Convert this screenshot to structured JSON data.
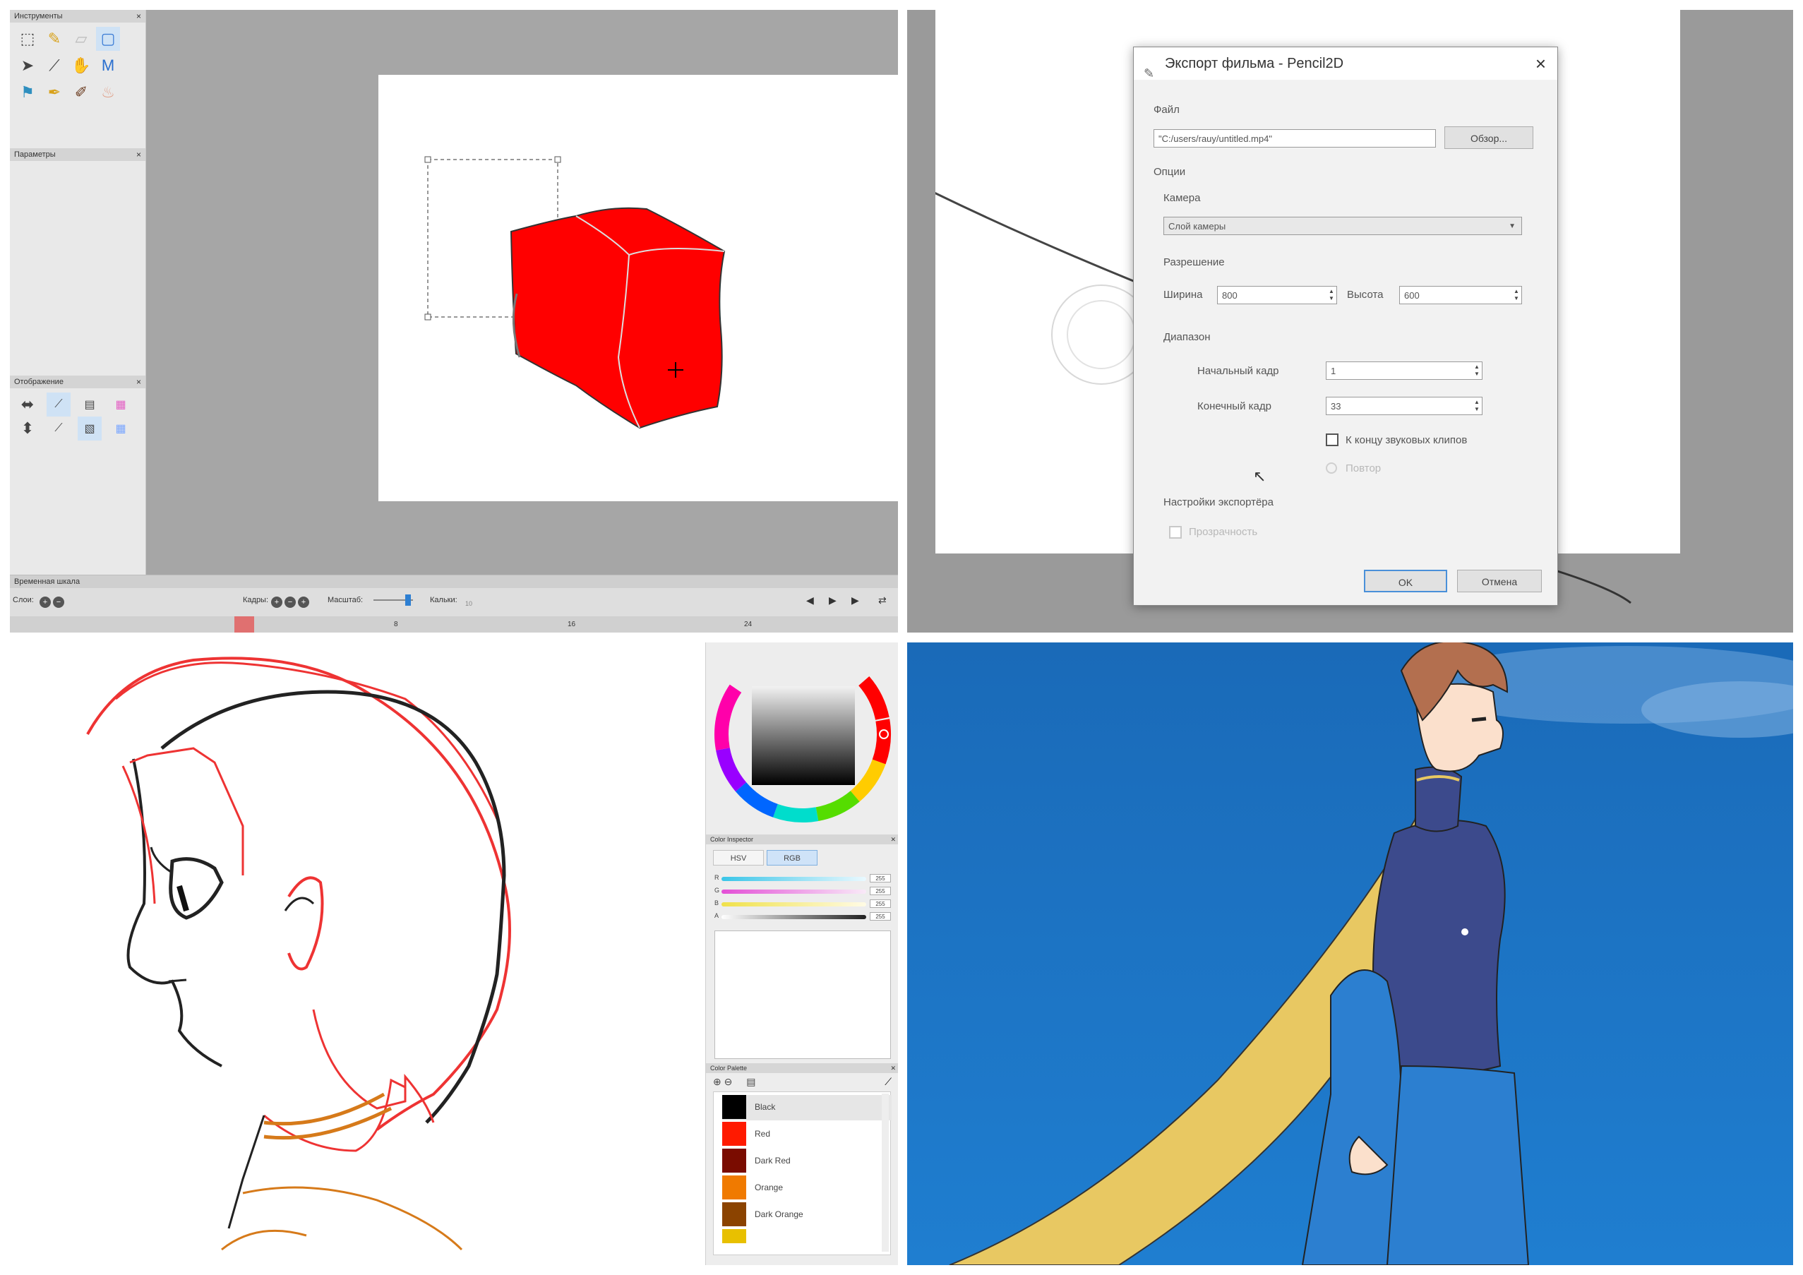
{
  "q1": {
    "docks": {
      "tools": "Инструменты",
      "options": "Параметры",
      "display": "Отображение",
      "timeline": "Временная шкала"
    },
    "tools": [
      "select-icon",
      "brush-icon",
      "eraser-icon",
      "rect-select-icon",
      "pointer-icon",
      "eyedropper-icon",
      "hand-icon",
      "smudge-icon",
      "pencil-icon",
      "pen-icon",
      "ink-icon",
      "bucket-icon"
    ],
    "timeline": {
      "layers_label": "Слои:",
      "frames_label": "Кадры:",
      "scale_label": "Масштаб:",
      "onion_label": "Кальки:",
      "ticks": [
        "8",
        "16",
        "24"
      ]
    },
    "colors": {
      "fill": "#ff0000",
      "canvas": "#ffffff"
    }
  },
  "q2": {
    "dialog_title": "Экспорт фильма - Pencil2D",
    "file_label": "Файл",
    "file_path": "\"C:/users/rauy/untitled.mp4\"",
    "browse": "Обзор...",
    "options_label": "Опции",
    "camera_label": "Камера",
    "camera_value": "Слой камеры",
    "resolution_label": "Разрешение",
    "width_label": "Ширина",
    "width_value": "800",
    "height_label": "Высота",
    "height_value": "600",
    "range_label": "Диапазон",
    "start_label": "Начальный кадр",
    "start_value": "1",
    "end_label": "Конечный кадр",
    "end_value": "33",
    "sound_clip_label": "К концу звуковых клипов",
    "loop_label": "Повтор",
    "exporter_label": "Настройки экспортёра",
    "transparency_label": "Прозрачность",
    "ok": "OK",
    "cancel": "Отмена"
  },
  "q3": {
    "inspector_title": "Color Inspector",
    "palette_title": "Color Palette",
    "tabs": [
      "HSV",
      "RGB"
    ],
    "active_tab": "RGB",
    "sliders": [
      {
        "letter": "R",
        "value": "255",
        "color": "#39c5e8"
      },
      {
        "letter": "G",
        "value": "255",
        "color": "#e34fd6"
      },
      {
        "letter": "B",
        "value": "255",
        "color": "#f0e14a"
      },
      {
        "letter": "A",
        "value": "255",
        "color": "#222222"
      }
    ],
    "palette": [
      {
        "name": "Black",
        "color": "#000000"
      },
      {
        "name": "Red",
        "color": "#ff1a00"
      },
      {
        "name": "Dark Red",
        "color": "#7a0c00"
      },
      {
        "name": "Orange",
        "color": "#f07a00"
      },
      {
        "name": "Dark Orange",
        "color": "#8b4300"
      }
    ]
  },
  "q4": {
    "colors": {
      "sky": "#1a6fc4",
      "cape": "#e8c862",
      "suit": "#3c4a8c",
      "pants": "#2c7fd0",
      "hair": "#b36f4f",
      "skin": "#fbe0cc"
    }
  }
}
